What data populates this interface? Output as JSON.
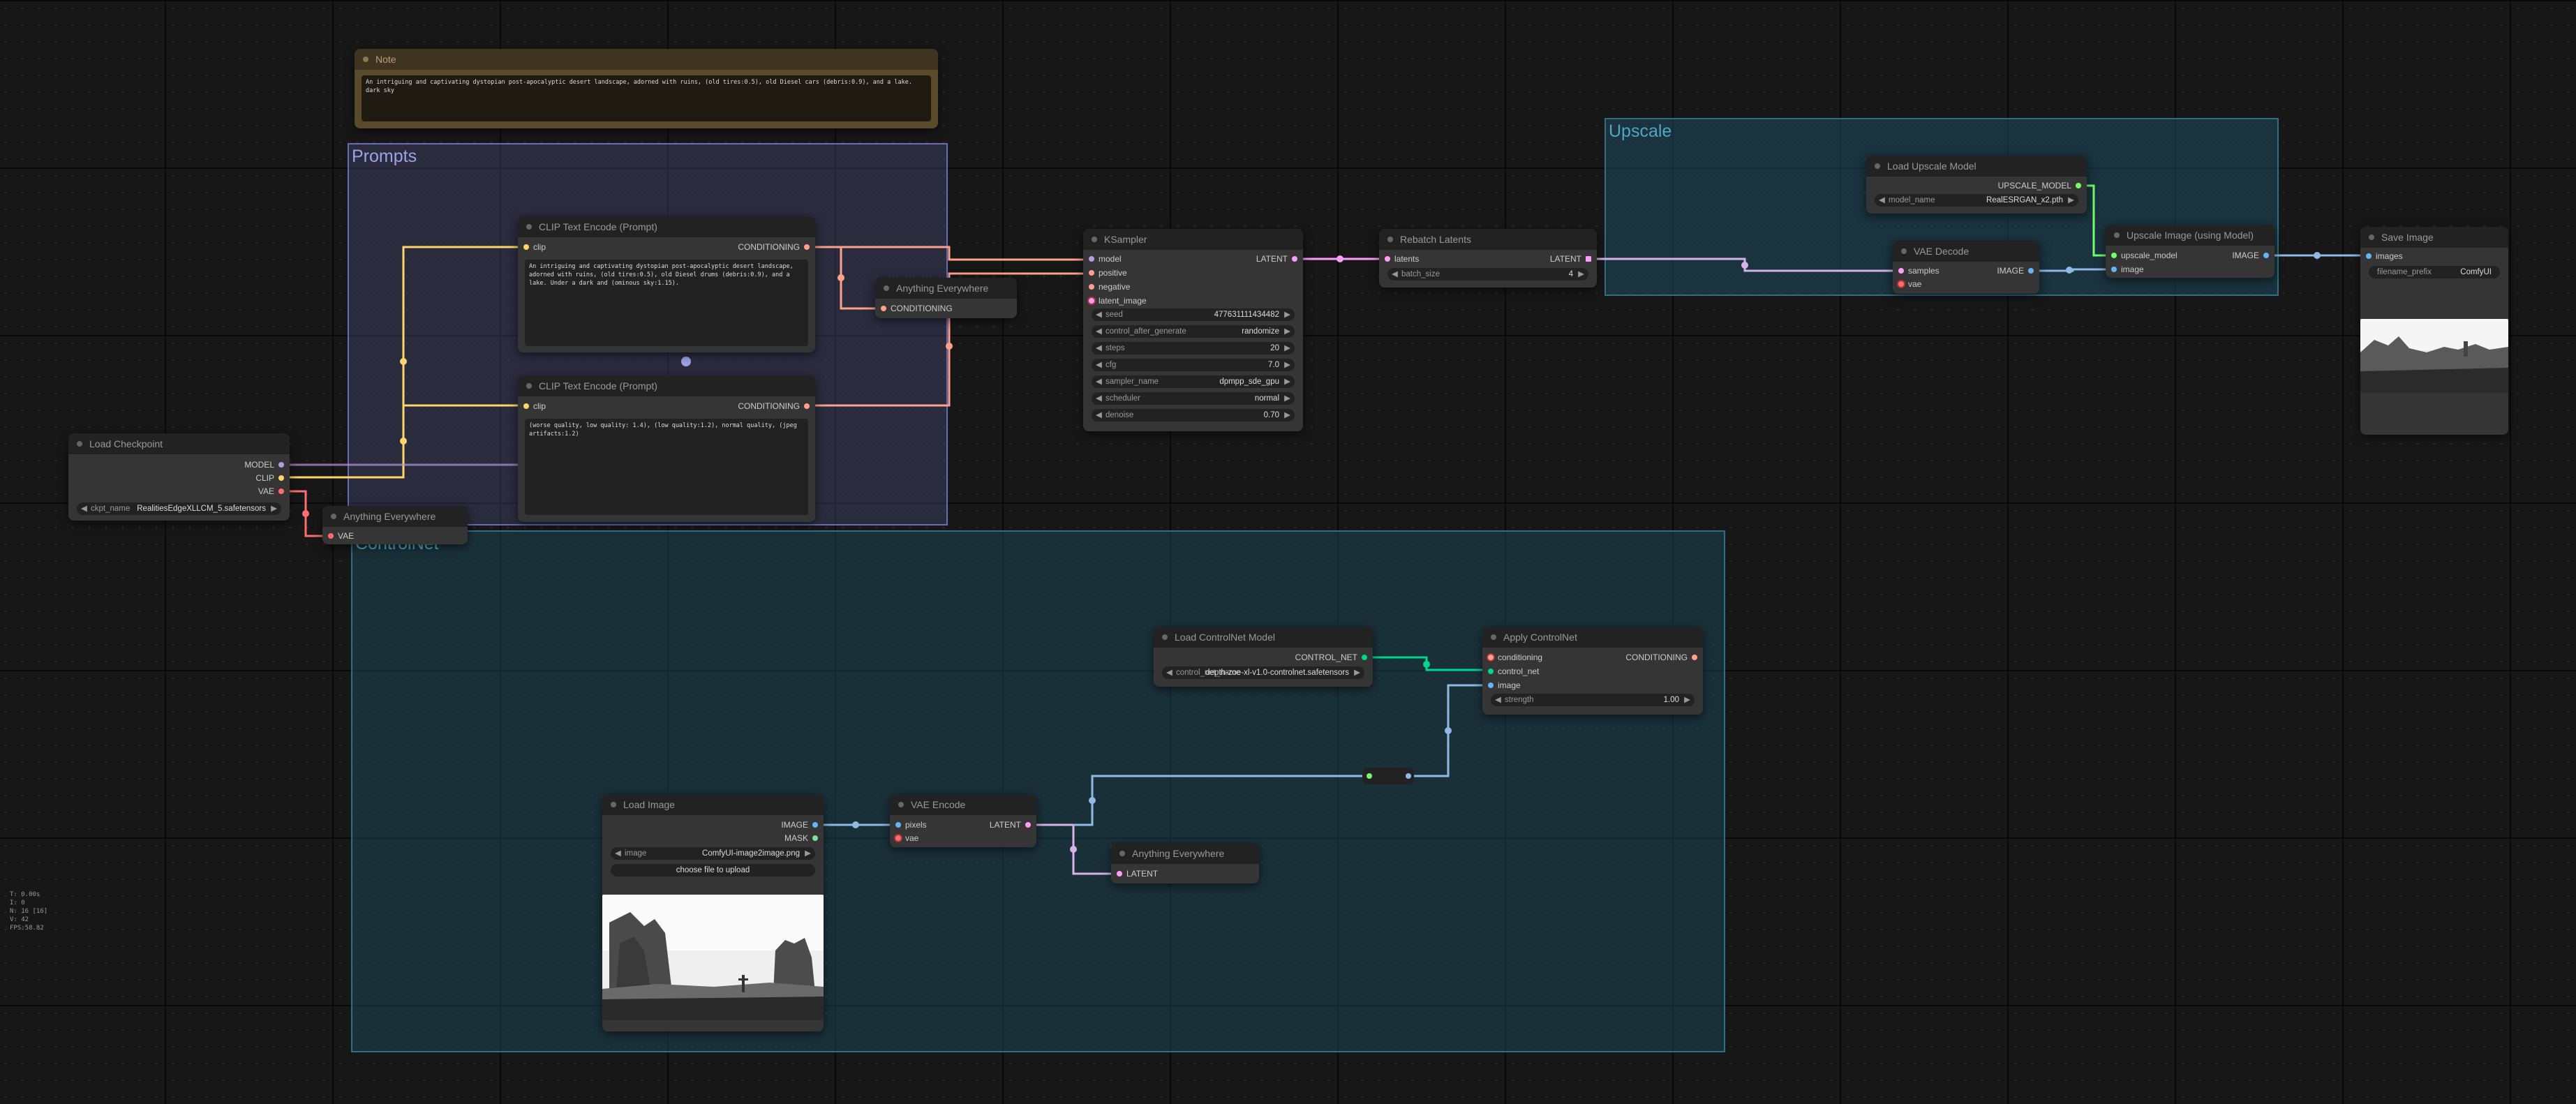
{
  "groups": {
    "prompts": {
      "title": "Prompts",
      "color": "#a1a1e8"
    },
    "upscale": {
      "title": "Upscale",
      "color": "#4ea8c4"
    },
    "controlnet": {
      "title": "ControlNet",
      "color": "#4ea8c4"
    }
  },
  "note": {
    "title": "Note",
    "text": "An intriguing and captivating dystopian post-apocalyptic desert landscape, adorned with ruins, (old tires:0.5), old Diesel cars (debris:0.9), and a lake. dark sky"
  },
  "clip_pos": {
    "title": "CLIP Text Encode (Prompt)",
    "input": "clip",
    "output": "CONDITIONING",
    "text": "An intriguing and captivating dystopian post-apocalyptic desert landscape, adorned with ruins, (old tires:0.5), old Diesel drums (debris:0.9), and a lake. Under a dark and (ominous sky:1.15)."
  },
  "clip_neg": {
    "title": "CLIP Text Encode (Prompt)",
    "input": "clip",
    "output": "CONDITIONING",
    "text": "(worse quality, low quality: 1.4), (low quality:1.2), normal quality, (jpeg artifacts:1.2)"
  },
  "ae_top": {
    "title": "Anything Everywhere",
    "input": "CONDITIONING"
  },
  "ae_vae": {
    "title": "Anything Everywhere",
    "input": "VAE"
  },
  "ae_latent": {
    "title": "Anything Everywhere",
    "input": "LATENT"
  },
  "checkpoint": {
    "title": "Load Checkpoint",
    "outputs": [
      "MODEL",
      "CLIP",
      "VAE"
    ],
    "widget_name": "ckpt_name",
    "widget_value": "RealitiesEdgeXLLCM_5.safetensors"
  },
  "ksampler": {
    "title": "KSampler",
    "inputs": [
      "model",
      "positive",
      "negative",
      "latent_image"
    ],
    "output": "LATENT",
    "widgets": [
      {
        "name": "seed",
        "value": "477631111434482"
      },
      {
        "name": "control_after_generate",
        "value": "randomize"
      },
      {
        "name": "steps",
        "value": "20"
      },
      {
        "name": "cfg",
        "value": "7.0"
      },
      {
        "name": "sampler_name",
        "value": "dpmpp_sde_gpu"
      },
      {
        "name": "scheduler",
        "value": "normal"
      },
      {
        "name": "denoise",
        "value": "0.70"
      }
    ]
  },
  "rebatch": {
    "title": "Rebatch Latents",
    "input": "latents",
    "output": "LATENT",
    "widget_name": "batch_size",
    "widget_value": "4"
  },
  "load_upscale": {
    "title": "Load Upscale Model",
    "output": "UPSCALE_MODEL",
    "widget_name": "model_name",
    "widget_value": "RealESRGAN_x2.pth"
  },
  "vae_decode": {
    "title": "VAE Decode",
    "inputs": [
      "samples",
      "vae"
    ],
    "output": "IMAGE"
  },
  "upscale_image": {
    "title": "Upscale Image (using Model)",
    "inputs": [
      "upscale_model",
      "image"
    ],
    "output": "IMAGE"
  },
  "save_image": {
    "title": "Save Image",
    "input": "images",
    "widget_name": "filename_prefix",
    "widget_value": "ComfyUI"
  },
  "load_controlnet": {
    "title": "Load ControlNet Model",
    "output": "CONTROL_NET",
    "widget_name": "control_net_name",
    "widget_value": "depth-zoe-xl-v1.0-controlnet.safetensors"
  },
  "apply_controlnet": {
    "title": "Apply ControlNet",
    "inputs": [
      "conditioning",
      "control_net",
      "image"
    ],
    "output": "CONDITIONING",
    "widget_name": "strength",
    "widget_value": "1.00"
  },
  "load_image": {
    "title": "Load Image",
    "outputs": [
      "IMAGE",
      "MASK"
    ],
    "widget_name": "image",
    "widget_value": "ComfyUI-image2image.png",
    "button": "choose file to upload"
  },
  "vae_encode": {
    "title": "VAE Encode",
    "inputs": [
      "pixels",
      "vae"
    ],
    "output": "LATENT"
  },
  "stats": [
    "T: 0.00s",
    "I: 0",
    "N: 16 [16]",
    "V: 42",
    "FPS:58.82"
  ],
  "colors": {
    "clip": "#ffd66b",
    "conditioning": "#ffa08a",
    "model": "#b39ddb",
    "latent": "#ff9cf9",
    "vae": "#ff6e6e",
    "image": "#64b5f6",
    "control_net": "#00d78d",
    "upscale": "#72ff6c",
    "wire_latent": "#d5b3e8",
    "wire_image": "#8fb9e6"
  }
}
